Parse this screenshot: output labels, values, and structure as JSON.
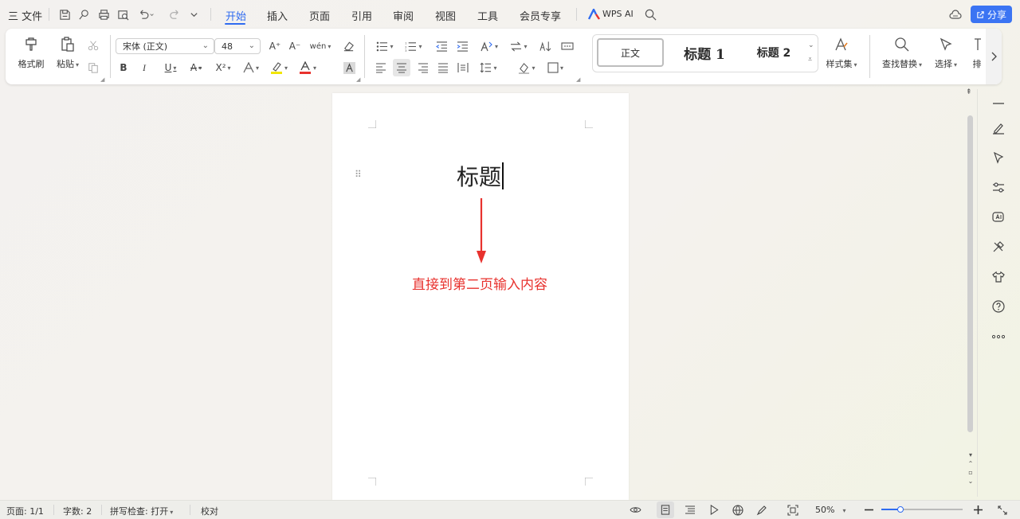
{
  "menubar": {
    "hamburger_label": "三 文件",
    "tabs": [
      "开始",
      "插入",
      "页面",
      "引用",
      "审阅",
      "视图",
      "工具",
      "会员专享"
    ],
    "wps_ai_label": "WPS AI",
    "share_label": "分享"
  },
  "ribbon": {
    "format_painter_label": "格式刷",
    "paste_label": "粘贴",
    "font_name": "宋体 (正文)",
    "font_size": "48",
    "font_grow": "A⁺",
    "font_shrink": "A⁻",
    "phonetic": "wén",
    "bold": "B",
    "italic": "I",
    "underline": "U",
    "strike": "A",
    "superscript": "X²",
    "styles": {
      "normal": "正文",
      "heading1": "标题 1",
      "heading2": "标题 2"
    },
    "style_set_label": "样式集",
    "find_replace_label": "查找替换",
    "select_label": "选择",
    "layout_label": "排"
  },
  "document": {
    "title_text": "标题",
    "annotation_text": "直接到第二页输入内容"
  },
  "statusbar": {
    "page": "页面: 1/1",
    "word_count": "字数: 2",
    "spell_check": "拼写检查: 打开",
    "proofread": "校对",
    "zoom": "50%",
    "zoom_level": 0.5
  },
  "colors": {
    "accent": "#2f6bf0",
    "annotation_red": "#e8322e",
    "share_button": "#3b74f3"
  }
}
